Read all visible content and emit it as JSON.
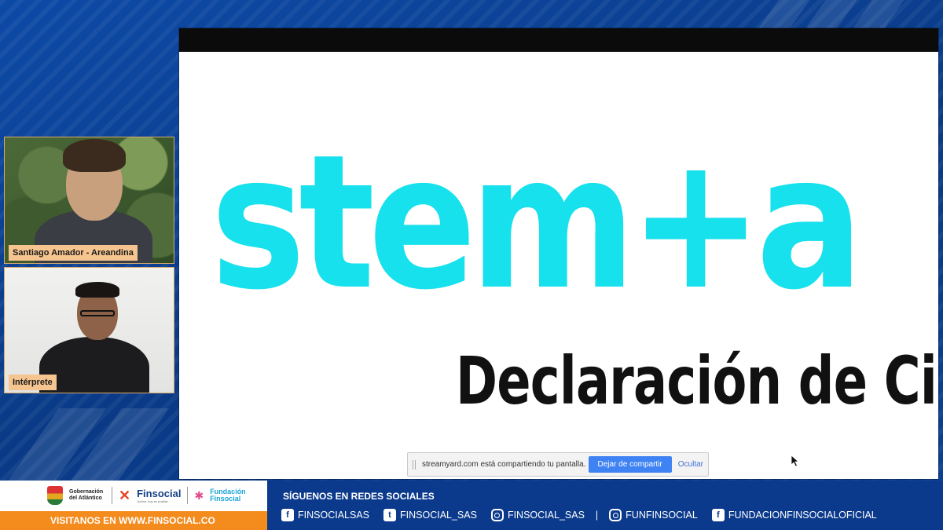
{
  "slide": {
    "logo_text": "stem+a",
    "title": "Declaración de Ciuda",
    "logo_color": "#17e1ec"
  },
  "share_bar": {
    "message": "streamyard.com está compartiendo tu pantalla.",
    "stop_label": "Dejar de compartir",
    "hide_label": "Ocultar"
  },
  "participants": [
    {
      "name": "Santiago Amador - Areandina"
    },
    {
      "name": "Intérprete"
    }
  ],
  "footer": {
    "logo_gobernacion": "Gobernación del Atlántico",
    "logo_finsocial": "Finsocial",
    "logo_finsocial_tagline": "Juntos, hoy es posible",
    "logo_fundacion": "Fundación Finsocial",
    "visit": "VISITANOS EN  WWW.FINSOCIAL.CO",
    "follow": "SÍGUENOS EN REDES SOCIALES",
    "socials": [
      {
        "icon": "facebook-icon",
        "handle": "FINSOCIALSAS"
      },
      {
        "icon": "twitter-icon",
        "handle": "FINSOCIAL_SAS"
      },
      {
        "icon": "instagram-icon",
        "handle": "FINSOCIAL_SAS"
      },
      {
        "icon": "instagram-icon",
        "handle": "FUNFINSOCIAL"
      },
      {
        "icon": "facebook-icon",
        "handle": "FUNDACIONFINSOCIALOFICIAL"
      }
    ],
    "separator": "|"
  },
  "colors": {
    "background": "#0a3a86",
    "accent_orange": "#f48b1d",
    "name_tag": "#f6c58f",
    "share_button": "#3f82f3"
  }
}
